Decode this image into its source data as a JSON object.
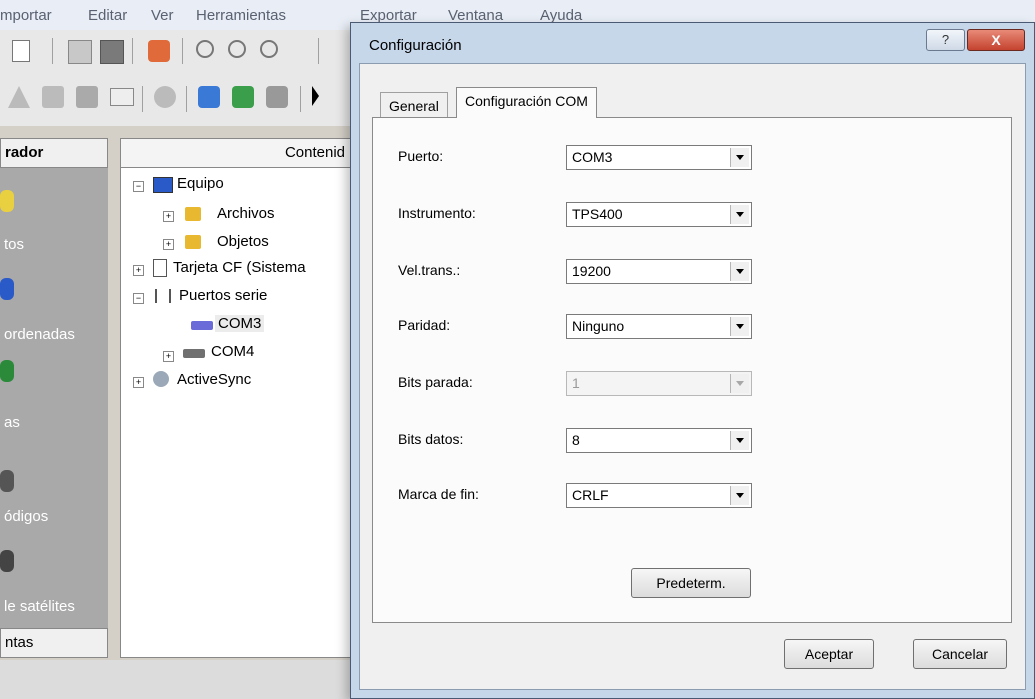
{
  "menubar": {
    "items": [
      "mportar",
      "Editar",
      "Ver",
      "Herramientas",
      "Exportar",
      "Ventana",
      "Ayuda"
    ]
  },
  "left_panel": {
    "header": "rador",
    "items": [
      "tos",
      "ordenadas",
      "as",
      "ódigos",
      "le satélites"
    ],
    "footer": "ntas"
  },
  "tree": {
    "header": "Contenid",
    "nodes": [
      {
        "label": "Equipo",
        "icon": "computer-icon"
      },
      {
        "label": "Archivos",
        "icon": "folder-icon"
      },
      {
        "label": "Objetos",
        "icon": "folder-icon"
      },
      {
        "label": "Tarjeta CF (Sistema",
        "icon": "card-icon"
      },
      {
        "label": "Puertos serie",
        "icon": "serial-port-icon"
      },
      {
        "label": "COM3",
        "icon": "port-icon"
      },
      {
        "label": "COM4",
        "icon": "port-icon"
      },
      {
        "label": "ActiveSync",
        "icon": "sync-icon"
      }
    ]
  },
  "dialog": {
    "title": "Configuración",
    "help_label": "?",
    "close_label": "X",
    "tabs": [
      "General",
      "Configuración COM"
    ],
    "fields": [
      {
        "label": "Puerto:",
        "value": "COM3",
        "enabled": true
      },
      {
        "label": "Instrumento:",
        "value": "TPS400",
        "enabled": true
      },
      {
        "label": "Vel.trans.:",
        "value": "19200",
        "enabled": true
      },
      {
        "label": "Paridad:",
        "value": "Ninguno",
        "enabled": true
      },
      {
        "label": "Bits parada:",
        "value": "1",
        "enabled": false
      },
      {
        "label": "Bits datos:",
        "value": "8",
        "enabled": true
      },
      {
        "label": "Marca de fin:",
        "value": "CRLF",
        "enabled": true
      }
    ],
    "default_button": "Predeterm.",
    "ok_button": "Aceptar",
    "cancel_button": "Cancelar"
  }
}
